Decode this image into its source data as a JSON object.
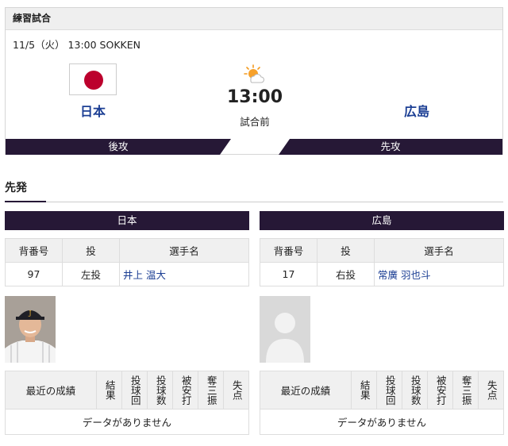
{
  "game": {
    "category": "練習試合",
    "info": "11/5（火） 13:00 SOKKEN",
    "home_team": "日本",
    "away_team": "広島",
    "time": "13:00",
    "status": "試合前",
    "home_side": "後攻",
    "away_side": "先攻",
    "weather_icon": "sun-cloud-icon"
  },
  "starters": {
    "title": "先発",
    "headers": {
      "number": "背番号",
      "throw": "投",
      "name": "選手名"
    },
    "home": {
      "team": "日本",
      "number": "97",
      "throw": "左投",
      "name": "井上 温大"
    },
    "away": {
      "team": "広島",
      "number": "17",
      "throw": "右投",
      "name": "常廣 羽也斗"
    }
  },
  "recent": {
    "header": "最近の成績",
    "columns": [
      "結果",
      "投球回",
      "投球数",
      "被安打",
      "奪三振",
      "失点"
    ],
    "empty": "データがありません"
  },
  "colors": {
    "accent": "#261836",
    "team_link": "#1c3f94",
    "flag_red": "#bc002d"
  }
}
